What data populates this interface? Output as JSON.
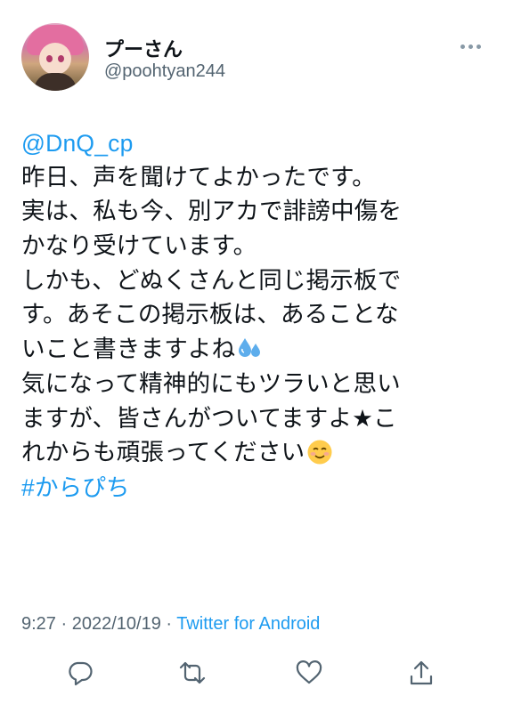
{
  "author": {
    "display_name": "プーさん",
    "handle": "@poohtyan244"
  },
  "tweet": {
    "mention": "@DnQ_cp",
    "lines": [
      " 昨日、声を聞けてよかったです。",
      "実は、私も今、別アカで誹謗中傷を",
      "かなり受けています。",
      "しかも、どぬくさんと同じ掲示板で",
      "す。あそこの掲示板は、あることな",
      "いこと書きますよね",
      "気になって精神的にもツラいと思い",
      "ますが、皆さんがついてますよ★こ",
      "れからも頑張ってください"
    ],
    "hashtag": "#からぴち"
  },
  "meta": {
    "time": "9:27",
    "separator": " · ",
    "date": "2022/10/19",
    "source": "Twitter for Android"
  },
  "actions": [
    "reply-icon",
    "retweet-icon",
    "like-icon",
    "share-icon"
  ],
  "colors": {
    "link": "#1d9bf0",
    "secondary_text": "#536471",
    "icon": "#536471"
  }
}
